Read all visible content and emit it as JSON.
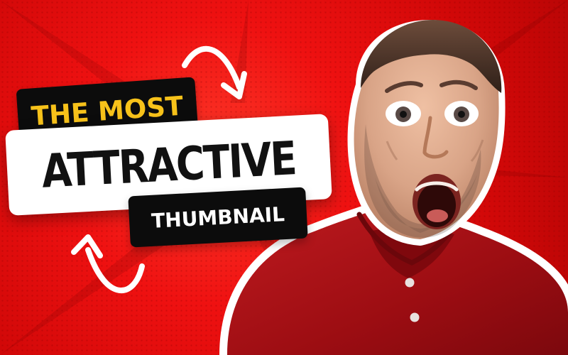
{
  "thumbnail": {
    "top_label": "THE MOST",
    "headline": "ATTRACTIVE",
    "bottom_label": "THUMBNAIL",
    "icons": {
      "top_arrow": "curved-arrow-icon",
      "bottom_arrow": "curved-arrow-icon"
    },
    "colors": {
      "background": "#e50d0d",
      "accent": "#f7c21a",
      "headline_background": "#ffffff",
      "label_background": "#0c0c0c",
      "headline_text": "#111111",
      "label_text": "#ffffff",
      "shirt": "#a50f12",
      "skin": "#d8a488",
      "hair": "#3d2b22"
    }
  }
}
